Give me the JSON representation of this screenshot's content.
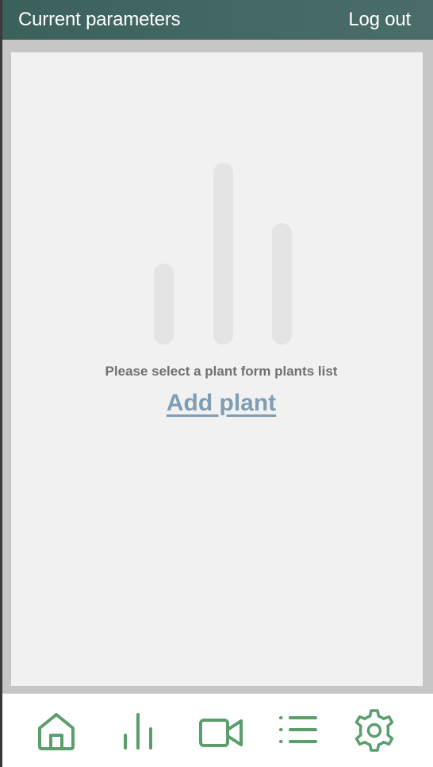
{
  "header": {
    "title": "Current parameters",
    "logout_label": "Log out"
  },
  "main": {
    "empty_message": "Please select a plant form plants list",
    "add_plant_label": "Add plant"
  },
  "bottom_nav": {
    "items": [
      {
        "icon": "home-icon"
      },
      {
        "icon": "bar-chart-icon"
      },
      {
        "icon": "video-camera-icon"
      },
      {
        "icon": "list-icon"
      },
      {
        "icon": "gear-icon"
      }
    ]
  },
  "colors": {
    "header_bg": "#426763",
    "accent_green": "#5a9e6c",
    "link": "#7f9db3",
    "panel_bg": "#f1f1f1",
    "placeholder_bar": "#e4e4e4"
  }
}
